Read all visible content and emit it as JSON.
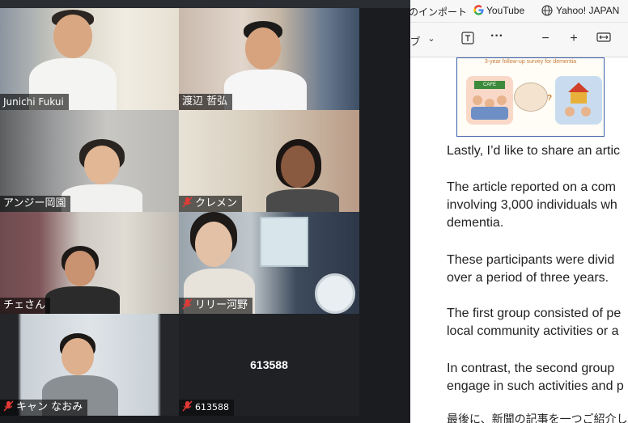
{
  "zoom": {
    "speaker_tiles": [
      {
        "name": "Junichi Fukui",
        "muted": false,
        "active": true
      },
      {
        "name": "渡辺 哲弘",
        "muted": false,
        "active": false
      },
      {
        "name": "アンジー岡園",
        "muted": false,
        "active": false
      },
      {
        "name": "クレメン",
        "muted": true,
        "active": false
      },
      {
        "name": "チェさん",
        "muted": false,
        "active": false
      },
      {
        "name": "リリー河野",
        "muted": true,
        "active": false
      },
      {
        "name": "キャン なおみ",
        "muted": true,
        "active": false
      }
    ],
    "no_video_tile": {
      "center_name": "613588",
      "label": "613588",
      "muted": true
    }
  },
  "browser": {
    "bookmarks": [
      {
        "label": "のインポート",
        "icon": "bookmark-import-icon"
      },
      {
        "label": "YouTube",
        "icon": "google-icon"
      },
      {
        "label": "Yahoo! JAPAN",
        "icon": "globe-icon"
      }
    ],
    "toolbar": {
      "draw_label": "ブ",
      "dropdown_icon": "chevron-down-icon",
      "text_icon": "text-box-icon",
      "more_icon": "more-dots-icon",
      "zoom_out_icon": "minus-icon",
      "zoom_in_icon": "plus-icon",
      "fit_icon": "fit-width-icon"
    },
    "document": {
      "image_caption": "3-year follow-up survey for dementia",
      "cafe_sign": "CAFE",
      "paragraphs": [
        [
          "Lastly, I’d like to share an artic"
        ],
        [
          "The article reported on a com",
          "involving 3,000 individuals wh",
          "dementia."
        ],
        [
          "These participants were divid",
          "over a period of three years."
        ],
        [
          "The first group consisted of pe",
          "local community activities or a"
        ],
        [
          "In contrast, the second group",
          "engage in such activities and p"
        ],
        [
          "最後に、新聞の記事を一つご紹介し"
        ]
      ]
    }
  },
  "colors": {
    "active_speaker_border": "#2ecc71",
    "zoom_background": "#1a1c1f",
    "muted_mic": "#e53935",
    "doc_image_border": "#3b5fa8"
  }
}
